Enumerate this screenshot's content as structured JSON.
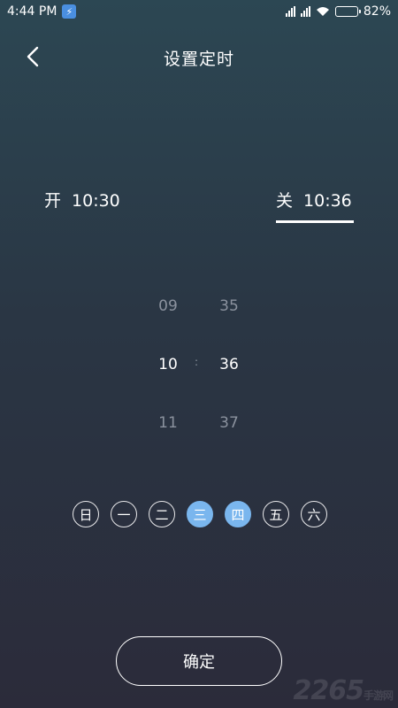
{
  "status_bar": {
    "time": "4:44 PM",
    "battery": "82%",
    "battery_level": 0.82
  },
  "header": {
    "title": "设置定时"
  },
  "tabs": {
    "on": {
      "label": "开",
      "time": "10:30"
    },
    "off": {
      "label": "关",
      "time": "10:36",
      "selected": true
    }
  },
  "picker": {
    "hours": [
      "09",
      "10",
      "11"
    ],
    "minutes": [
      "35",
      "36",
      "37"
    ],
    "separator": ":"
  },
  "days": [
    {
      "label": "日",
      "active": false
    },
    {
      "label": "一",
      "active": false
    },
    {
      "label": "二",
      "active": false
    },
    {
      "label": "三",
      "active": true
    },
    {
      "label": "四",
      "active": true
    },
    {
      "label": "五",
      "active": false
    },
    {
      "label": "六",
      "active": false
    }
  ],
  "confirm_label": "确定",
  "accent_color": "#7ab6ee",
  "watermark": {
    "text": "2265",
    "sub": "手游网"
  }
}
